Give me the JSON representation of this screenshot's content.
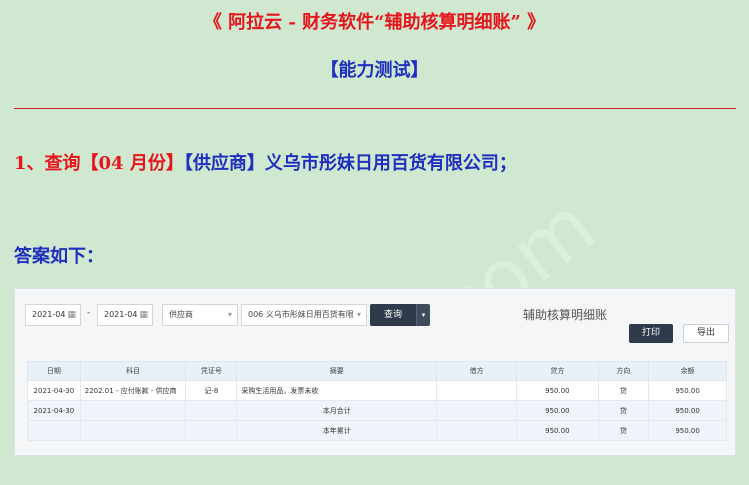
{
  "header": {
    "title": "《 阿拉云 - 财务软件“辅助核算明细账” 》",
    "subtitle": "【能力测试】"
  },
  "question": {
    "red": "1、查询【04 月份】",
    "blue": "【供应商】义乌市彤妹日用百货有限公司；"
  },
  "answer_label": "答案如下：",
  "watermark": ".com",
  "toolbar": {
    "date_from": "2021-04",
    "date_separator": "-",
    "date_to": "2021-04",
    "category_select": "供应商",
    "entity_select": "006 义乌市彤妹日用百货有限",
    "query_label": "查询",
    "query_caret": "▾",
    "panel_title": "辅助核算明细账",
    "print_label": "打印",
    "export_label": "导出",
    "calendar_icon": "calendar-icon",
    "caret_icon": "▾"
  },
  "table": {
    "headers": [
      "日期",
      "科目",
      "凭证号",
      "摘要",
      "借方",
      "贷方",
      "方向",
      "余额"
    ],
    "rows": [
      {
        "date": "2021-04-30",
        "subject": "2202.01 - 应付账款 - 供应商",
        "voucher": "记-8",
        "summary": "采购生活用品，发票未收",
        "debit": "",
        "credit": "950.00",
        "direction": "贷",
        "balance": "950.00"
      },
      {
        "date": "2021-04-30",
        "subject": "",
        "voucher": "",
        "summary": "本月合计",
        "debit": "",
        "credit": "950.00",
        "direction": "贷",
        "balance": "950.00"
      },
      {
        "date": "",
        "subject": "",
        "voucher": "",
        "summary": "本年累计",
        "debit": "",
        "credit": "950.00",
        "direction": "贷",
        "balance": "950.00"
      }
    ]
  },
  "colors": {
    "background": "#cfe8cf",
    "title_red": "#e8141c",
    "title_blue": "#1f2fbf",
    "button_dark": "#2f3a4a"
  }
}
